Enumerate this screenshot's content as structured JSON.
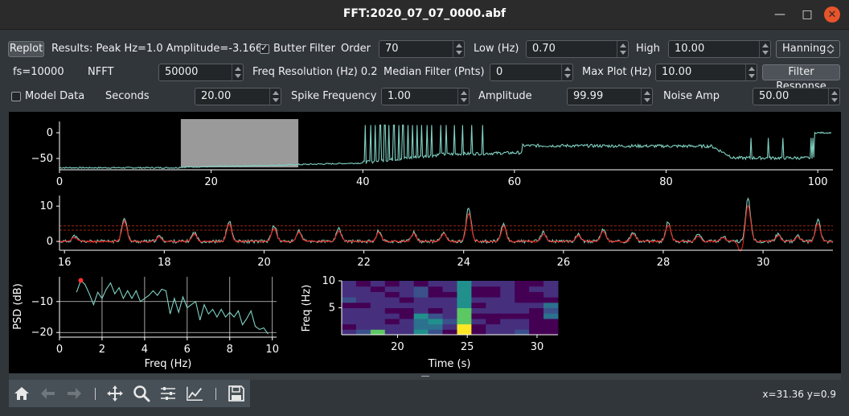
{
  "window": {
    "title": "FFT:2020_07_07_0000.abf",
    "minimize_glyph": "—",
    "maximize_glyph": "□",
    "close_glyph": "✕"
  },
  "controls": {
    "replot_label": "Replot",
    "results_text": "Results: Peak Hz=1.0 Amplitude=-3.166",
    "butter_filter": {
      "label": "Butter Filter",
      "checked": true
    },
    "order": {
      "label": "Order",
      "value": "70"
    },
    "low": {
      "label": "Low (Hz)",
      "value": "0.70"
    },
    "high": {
      "label": "High",
      "value": "10.00"
    },
    "window_fn": {
      "selected": "Hanning"
    },
    "fs_text": "fs=10000",
    "nfft": {
      "label": "NFFT",
      "value": "50000"
    },
    "freq_resolution_text": "Freq Resolution (Hz) 0.2",
    "median_filter": {
      "label": "Median Filter (Pnts)",
      "value": "0"
    },
    "max_plot": {
      "label": "Max Plot (Hz)",
      "value": "10.00"
    },
    "filter_response_label": "Filter Response",
    "model_data": {
      "label": "Model Data",
      "checked": false
    },
    "seconds": {
      "label": "Seconds",
      "value": "20.00"
    },
    "spike_frequency": {
      "label": "Spike Frequency",
      "value": "1.00"
    },
    "amplitude": {
      "label": "Amplitude",
      "value": "99.99"
    },
    "noise_amp": {
      "label": "Noise Amp",
      "value": "50.00"
    }
  },
  "plots": {
    "raw": {
      "y_ticks": [
        "0",
        "−50"
      ],
      "x_ticks": [
        "0",
        "20",
        "40",
        "60",
        "80",
        "100"
      ],
      "x_range": [
        0,
        102
      ],
      "y_range": [
        -72,
        25
      ],
      "selection_x": [
        16,
        31.5
      ],
      "trace_color": "#7fd1c2"
    },
    "zoom": {
      "y_ticks": [
        "10",
        "0"
      ],
      "x_ticks": [
        "16",
        "18",
        "20",
        "22",
        "24",
        "26",
        "28",
        "30"
      ],
      "x_range": [
        15.9,
        31.4
      ],
      "y_range": [
        -2.5,
        13
      ],
      "filtered_color": "#e8211a",
      "raw_color": "#7fd1c2",
      "threshold_color": "#d0301d"
    },
    "psd": {
      "ylabel": "PSD (dB)",
      "xlabel": "Freq (Hz)",
      "y_ticks": [
        "−10",
        "−20"
      ],
      "x_ticks": [
        "0",
        "2",
        "4",
        "6",
        "8",
        "10"
      ],
      "x_range": [
        0,
        10.2
      ],
      "y_range": [
        -21.5,
        -2
      ],
      "peak": {
        "hz": 1.0,
        "db": -3.166
      },
      "peak_color": "#ff3030"
    },
    "spectrogram": {
      "ylabel": "Freq (Hz)",
      "xlabel": "Time (s)",
      "y_ticks": [
        "10",
        "5"
      ],
      "x_ticks": [
        "20",
        "25",
        "30"
      ],
      "x_range": [
        16,
        31.5
      ],
      "y_range": [
        0,
        10
      ]
    }
  },
  "toolbar": {
    "icons": [
      "home-icon",
      "back-arrow-icon",
      "forward-arrow-icon",
      "pan-icon",
      "zoom-icon",
      "subplots-icon",
      "axes-edit-icon",
      "save-icon"
    ]
  },
  "status": {
    "coords": "x=31.36 y=0.9"
  }
}
